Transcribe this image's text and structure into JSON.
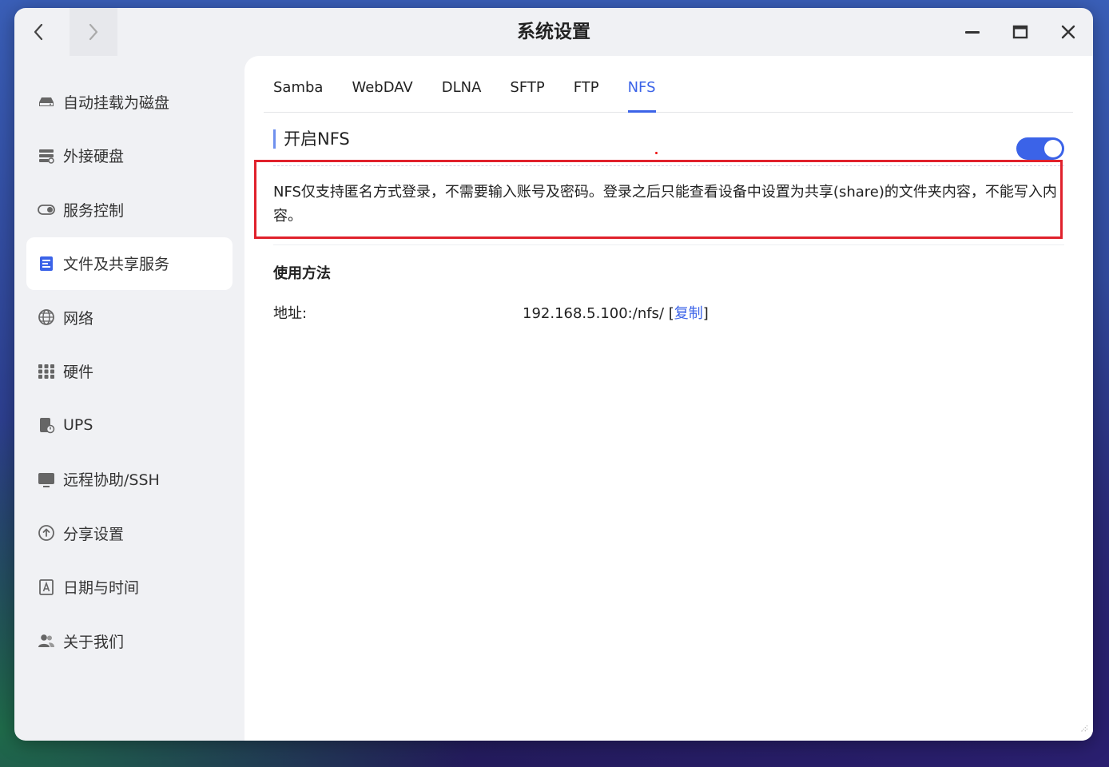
{
  "window": {
    "title": "系统设置"
  },
  "sidebar": {
    "items": [
      {
        "label": "自动挂载为磁盘",
        "icon": "drive-icon"
      },
      {
        "label": "外接硬盘",
        "icon": "external-disk-icon"
      },
      {
        "label": "服务控制",
        "icon": "toggle-icon"
      },
      {
        "label": "文件及共享服务",
        "icon": "file-share-icon",
        "active": true
      },
      {
        "label": "网络",
        "icon": "globe-icon"
      },
      {
        "label": "硬件",
        "icon": "grid-icon"
      },
      {
        "label": "UPS",
        "icon": "ups-icon"
      },
      {
        "label": "远程协助/SSH",
        "icon": "remote-icon"
      },
      {
        "label": "分享设置",
        "icon": "share-icon"
      },
      {
        "label": "日期与时间",
        "icon": "calendar-icon"
      },
      {
        "label": "关于我们",
        "icon": "users-icon"
      }
    ]
  },
  "tabs": [
    "Samba",
    "WebDAV",
    "DLNA",
    "SFTP",
    "FTP",
    "NFS"
  ],
  "active_tab": "NFS",
  "nfs": {
    "section_title": "开启NFS",
    "enabled": true,
    "notice": "NFS仅支持匿名方式登录，不需要输入账号及密码。登录之后只能查看设备中设置为共享(share)的文件夹内容，不能写入内容。",
    "usage_title": "使用方法",
    "address_label": "地址:",
    "address_value": "192.168.5.100:/nfs/",
    "copy_bracket_open": "[",
    "copy_label": "复制",
    "copy_bracket_close": "]"
  },
  "colors": {
    "accent": "#3b63e8",
    "highlight_border": "#e0212c"
  }
}
